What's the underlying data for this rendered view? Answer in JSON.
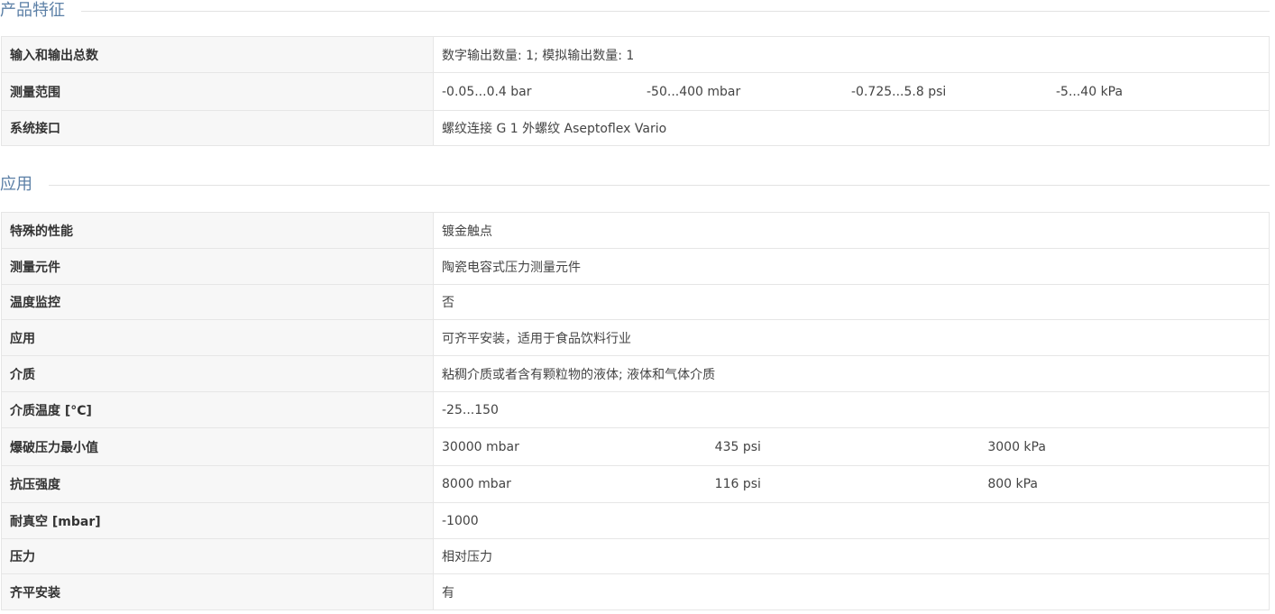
{
  "sections": {
    "features": {
      "title": "产品特征",
      "rows": [
        {
          "label": "输入和输出总数",
          "value": "数字输出数量: 1; 模拟输出数量: 1"
        },
        {
          "label": "测量范围",
          "values": [
            "-0.05...0.4 bar",
            "-50...400 mbar",
            "-0.725...5.8 psi",
            "-5...40 kPa"
          ]
        },
        {
          "label": "系统接口",
          "value": "螺纹连接 G 1 外螺纹 Aseptoflex Vario"
        }
      ]
    },
    "application": {
      "title": "应用",
      "rows": [
        {
          "label": "特殊的性能",
          "value": "镀金触点"
        },
        {
          "label": "测量元件",
          "value": "陶瓷电容式压力测量元件"
        },
        {
          "label": "温度监控",
          "value": "否"
        },
        {
          "label": "应用",
          "value": "可齐平安装，适用于食品饮料行业"
        },
        {
          "label": "介质",
          "value": "粘稠介质或者含有颗粒物的液体; 液体和气体介质"
        },
        {
          "label": "介质温度 [°C]",
          "value": "-25...150"
        },
        {
          "label": "爆破压力最小值",
          "values": [
            "30000 mbar",
            "435 psi",
            "3000 kPa"
          ]
        },
        {
          "label": "抗压强度",
          "values": [
            "8000 mbar",
            "116 psi",
            "800 kPa"
          ]
        },
        {
          "label": "耐真空 [mbar]",
          "value": "-1000"
        },
        {
          "label": "压力",
          "value": "相对压力"
        },
        {
          "label": "齐平安装",
          "value": "有"
        }
      ]
    }
  }
}
